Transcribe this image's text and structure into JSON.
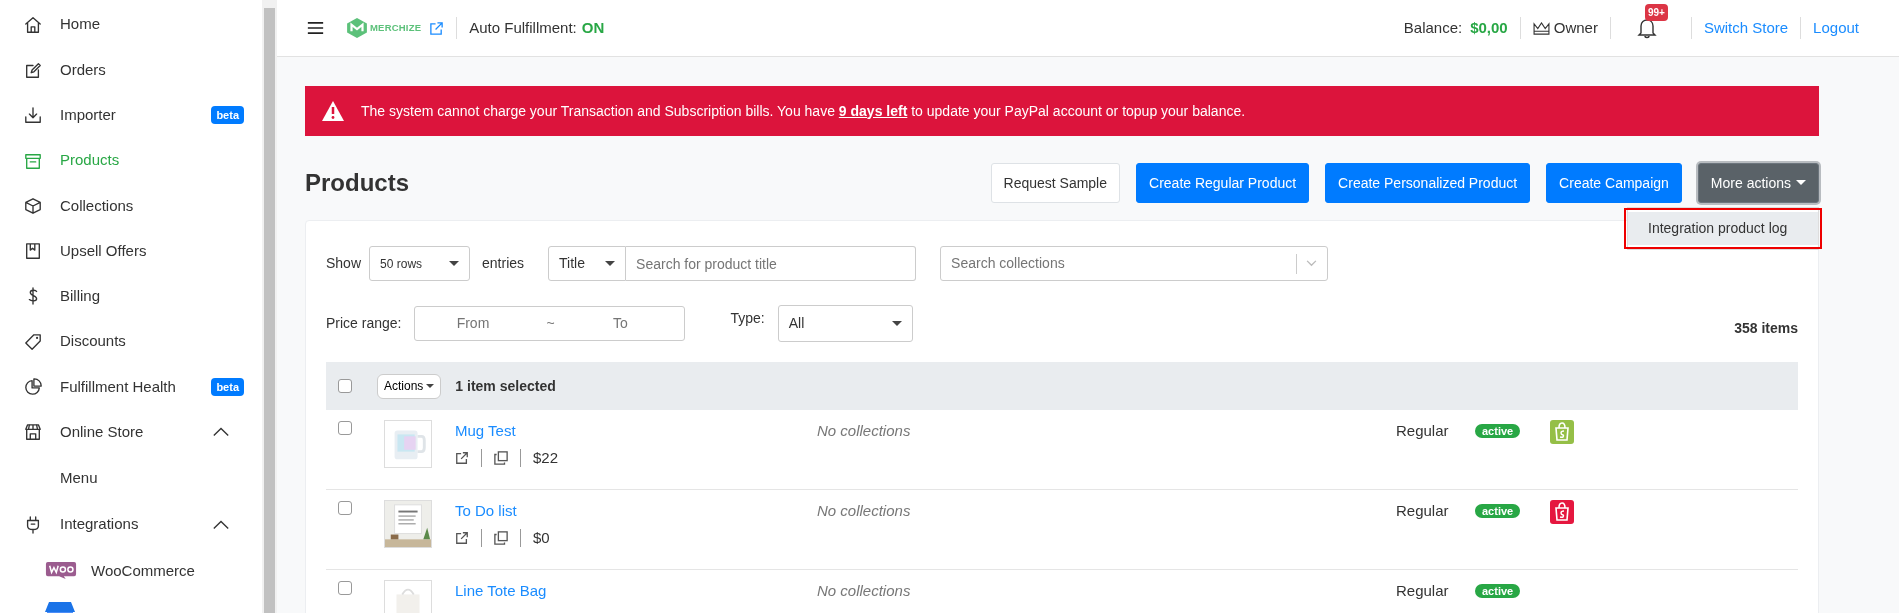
{
  "sidebar": {
    "items": [
      {
        "label": "Home",
        "selected": false
      },
      {
        "label": "Orders",
        "selected": false
      },
      {
        "label": "Importer",
        "badge": "beta",
        "selected": false
      },
      {
        "label": "Products",
        "selected": true
      },
      {
        "label": "Collections",
        "selected": false
      },
      {
        "label": "Upsell Offers",
        "selected": false
      },
      {
        "label": "Billing",
        "selected": false
      },
      {
        "label": "Discounts",
        "selected": false
      },
      {
        "label": "Fulfillment Health",
        "badge": "beta",
        "selected": false
      },
      {
        "label": "Online Store",
        "selected": false,
        "expanded": true,
        "children": [
          {
            "kind": "text",
            "label": "Menu"
          }
        ]
      },
      {
        "label": "Integrations",
        "selected": false,
        "expanded": true,
        "children": [
          {
            "kind": "logo",
            "label": "WooCommerce"
          },
          {
            "kind": "cut"
          }
        ]
      }
    ]
  },
  "topbar": {
    "logo": "MERCHIZE",
    "auto_fulfillment": {
      "label": "Auto Fulfillment:",
      "value": "ON",
      "on": true
    },
    "balance": {
      "label": "Balance:",
      "value": "$0,00"
    },
    "role": "Owner",
    "notifications": "99+",
    "links": [
      "Switch Store",
      "Logout"
    ]
  },
  "alert": "The system cannot charge your Transaction and Subscription bills. You have **9 days left** to update your PayPal account or topup your balance.",
  "page": {
    "title": "Products",
    "buttons": [
      {
        "label": "Request Sample",
        "kind": "outline"
      },
      {
        "label": "Create Regular Product",
        "kind": "primary"
      },
      {
        "label": "Create Personalized Product",
        "kind": "primary"
      },
      {
        "label": "Create Campaign",
        "kind": "primary"
      },
      {
        "label": "More actions",
        "kind": "dropdown",
        "expanded": true,
        "menu": [
          {
            "label": "Integration product log",
            "highlighted": true
          }
        ]
      }
    ]
  },
  "filters": {
    "show_label": "Show",
    "rows": "50 rows",
    "entries_label": "entries",
    "search_by": "Title",
    "search_placeholder": "Search for product title",
    "collections_placeholder": "Search collections",
    "price_label": "Price range:",
    "price_from_placeholder": "From",
    "price_separator": "~",
    "price_to_placeholder": "To",
    "type_label": "Type:",
    "type_value": "All",
    "count": "358 items"
  },
  "table": {
    "header": {
      "checked": false,
      "actions": "Actions",
      "selection": "1 item selected"
    },
    "rows": [
      {
        "checked": false,
        "title": "Mug Test",
        "price": "$22",
        "collections": "No collections",
        "type": "Regular",
        "status": "active",
        "color": "#95bf47"
      },
      {
        "checked": false,
        "title": "To Do list",
        "price": "$0",
        "collections": "No collections",
        "type": "Regular",
        "status": "active",
        "color": "#e5173f"
      },
      {
        "checked": false,
        "title": "Line Tote Bag",
        "collections": "No collections",
        "type": "Regular",
        "status": "active"
      }
    ]
  }
}
